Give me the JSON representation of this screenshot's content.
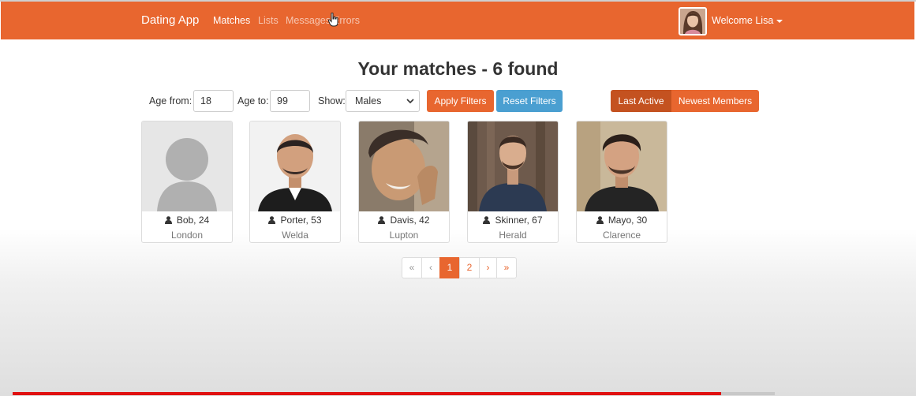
{
  "navbar": {
    "brand": "Dating App",
    "links": [
      {
        "label": "Matches",
        "active": true
      },
      {
        "label": "Lists",
        "active": false
      },
      {
        "label": "Messages",
        "active": false
      },
      {
        "label": "Errors",
        "active": false
      }
    ],
    "welcome": "Welcome Lisa"
  },
  "page": {
    "title": "Your matches - 6 found"
  },
  "filters": {
    "age_from_label": "Age from:",
    "age_from_value": "18",
    "age_to_label": "Age to:",
    "age_to_value": "99",
    "show_label": "Show:",
    "show_value": "Males",
    "apply_label": "Apply Filters",
    "reset_label": "Reset Filters",
    "sort_options": [
      "Last Active",
      "Newest Members"
    ],
    "sort_selected": "Last Active"
  },
  "members": [
    {
      "name_age": "Bob, 24",
      "city": "London",
      "photo": "placeholder-avatar"
    },
    {
      "name_age": "Porter, 53",
      "city": "Welda",
      "photo": "man-photo"
    },
    {
      "name_age": "Davis, 42",
      "city": "Lupton",
      "photo": "man-photo"
    },
    {
      "name_age": "Skinner, 67",
      "city": "Herald",
      "photo": "man-photo"
    },
    {
      "name_age": "Mayo, 30",
      "city": "Clarence",
      "photo": "man-photo"
    }
  ],
  "pagination": {
    "first": "«",
    "prev": "‹",
    "pages": [
      "1",
      "2"
    ],
    "current": "1",
    "next": "›",
    "last": "»"
  },
  "video": {
    "progress_fraction": 0.93
  },
  "colors": {
    "primary": "#e8662f",
    "info": "#4a9fd1",
    "active_segment": "#c45220",
    "progress": "#e01010"
  }
}
